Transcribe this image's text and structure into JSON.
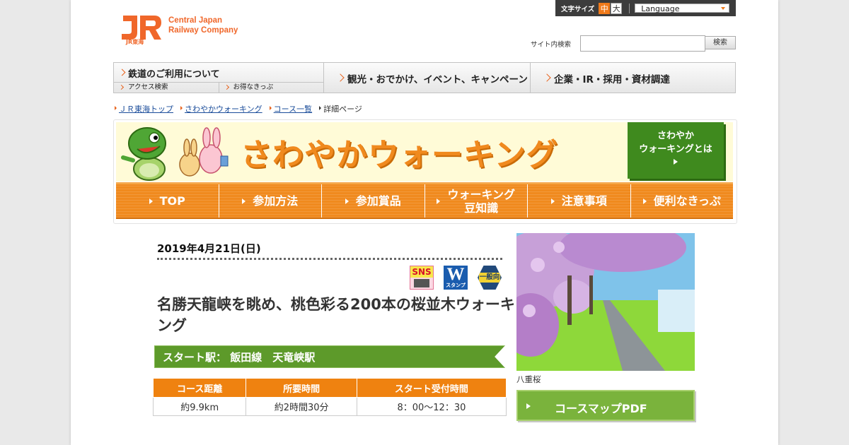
{
  "header": {
    "logo_alt": "JR東海",
    "company_line1": "Central Japan",
    "company_line2": "Railway Company",
    "font_size_label": "文字サイズ",
    "font_size_medium": "中",
    "font_size_large": "大",
    "language_label": "Language",
    "site_search_label": "サイト内検索",
    "site_search_button": "検索"
  },
  "global_nav": {
    "railway_use": "鉄道のご利用について",
    "access_search": "アクセス検索",
    "value_tickets": "お得なきっぷ",
    "sightseeing": "観光・おでかけ、イベント、キャンペーン",
    "corporate": "企業・IR・採用・資材調達"
  },
  "breadcrumb": [
    {
      "label": "ＪＲ東海トップ"
    },
    {
      "label": "さわやかウォーキング"
    },
    {
      "label": "コース一覧"
    },
    {
      "label": "詳細ページ"
    }
  ],
  "banner": {
    "title": "さわやかウォーキング",
    "about_line1": "さわやか",
    "about_line2": "ウォーキングとは"
  },
  "sub_nav": [
    {
      "label": "TOP"
    },
    {
      "label": "参加方法"
    },
    {
      "label": "参加賞品"
    },
    {
      "label": "ウォーキング\n豆知識"
    },
    {
      "label": "注意事項"
    },
    {
      "label": "便利なきっぷ"
    }
  ],
  "detail": {
    "date": "2019年4月21日(日)",
    "badges": {
      "sns": "SNS",
      "w": "W",
      "w_sub": "スタンプ",
      "general": "一般向"
    },
    "title": "名勝天龍峡を眺め、桃色彩る200本の桜並木ウォーキング",
    "start_station": "スタート駅：  飯田線　天竜峡駅",
    "info_headers": [
      "コース距離",
      "所要時間",
      "スタート受付時間"
    ],
    "info_values": [
      "約9.9km",
      "約2時間30分",
      "8：00～12：30"
    ],
    "photo_caption": "八重桜",
    "pdf_button": "コースマップPDF"
  },
  "colors": {
    "jr_orange": "#f0672a",
    "banner_orange": "#f08a1e",
    "green": "#5d9a2a",
    "table_header": "#ef8210"
  }
}
